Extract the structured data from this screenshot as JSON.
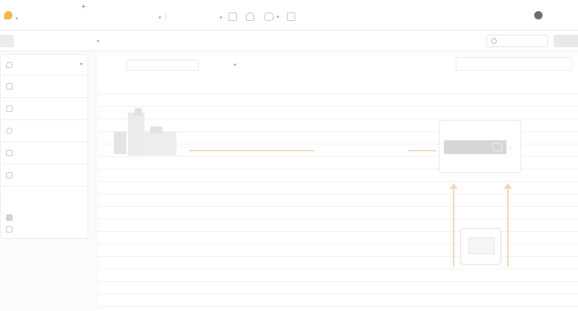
{
  "app": {
    "logo_text": "",
    "title": "",
    "subtitle": "",
    "plus_label": "+",
    "accent_color": "#f2b64a",
    "logo_color": "#6f7fd0"
  },
  "topbar": {
    "menu_1": "",
    "menu_2": "",
    "search_text": "",
    "user_name": "",
    "icons": [
      "list-icon",
      "people-icon",
      "view-icon",
      "square-icon"
    ]
  },
  "nav": {
    "items": [
      "",
      "",
      "",
      "",
      "",
      "",
      ""
    ],
    "search_placeholder": "",
    "action_label": ""
  },
  "sidebar": {
    "dropdown_label": "",
    "items": [
      "",
      "",
      "",
      "",
      ""
    ],
    "section_title": "",
    "section_subtitle": "",
    "sub_items": [
      "",
      ""
    ]
  },
  "toolbar": {
    "label_1": "",
    "field_value": "",
    "field_count": "",
    "dropdown_label": "",
    "label_2": "",
    "label_3": "",
    "label_4": "",
    "label_5": "",
    "label_6": "",
    "caption": "",
    "panel_title": ""
  },
  "diagram": {
    "node_1_title": "",
    "node_1_sub": "",
    "link_title": "",
    "link_sub": "",
    "card_title": "",
    "card_sub": "",
    "bottom_title": "",
    "bottom_sub": "",
    "link_color": "#ecdcc0",
    "arrow_color": "#f1d6b4"
  }
}
